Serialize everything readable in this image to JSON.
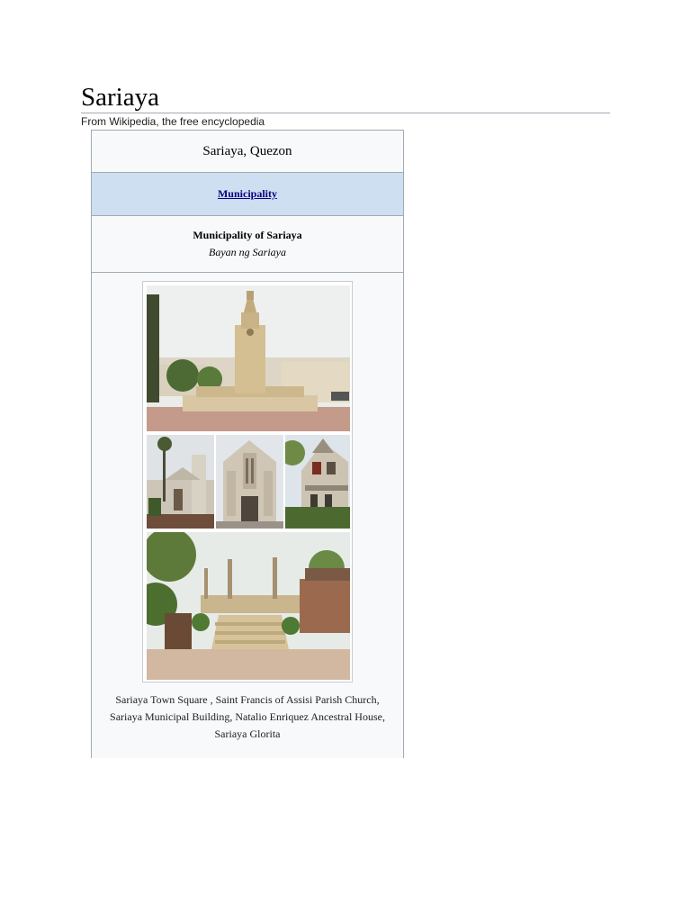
{
  "article": {
    "title": "Sariaya",
    "tagline": "From Wikipedia, the free encyclopedia"
  },
  "infobox": {
    "name": "Sariaya, Quezon",
    "settlement_type": "Municipality",
    "official_name": "Municipality of Sariaya",
    "native_name": "Bayan ng Sariaya",
    "montage_photos": [
      {
        "subject": "Sariaya Town Square"
      },
      {
        "subject": "Saint Francis of Assisi Parish Church"
      },
      {
        "subject": "Sariaya Municipal Building"
      },
      {
        "subject": "Natalio Enriquez Ancestral House"
      },
      {
        "subject": "Sariaya Glorita"
      }
    ],
    "caption_lines": [
      "Sariaya Town Square , Saint Francis of Assisi Parish Church,",
      "Sariaya Municipal Building, Natalio Enriquez Ancestral House,",
      "Sariaya Glorita"
    ]
  },
  "colors": {
    "link": "#0b0080",
    "header_band": "#cedff2",
    "infobox_bg": "#f8f9fa",
    "border": "#a2a9b1"
  }
}
